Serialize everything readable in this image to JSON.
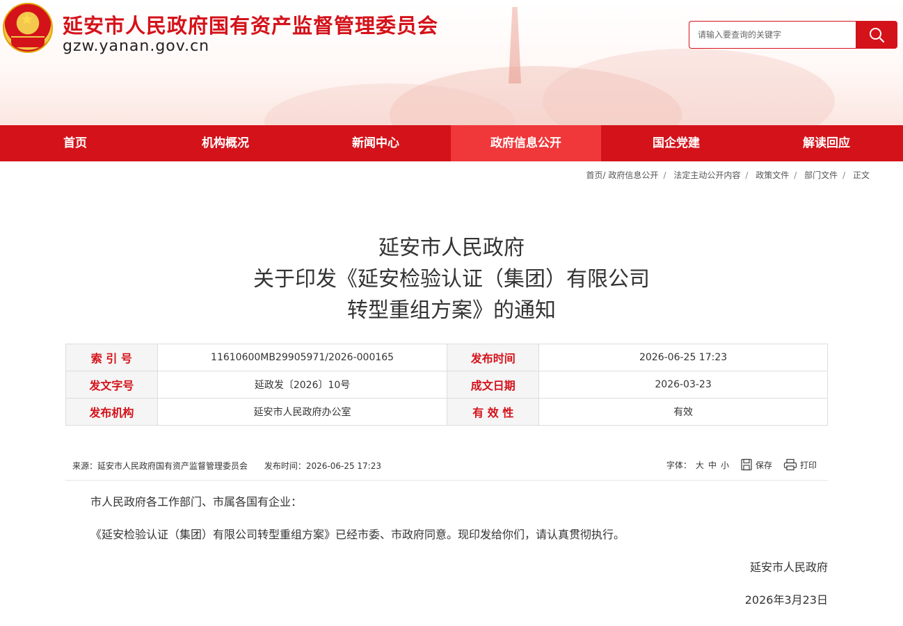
{
  "site": {
    "title": "延安市人民政府国有资产监督管理委员会",
    "domain": "gzw.yanan.gov.cn"
  },
  "search": {
    "placeholder": "请输入要查询的关键字",
    "icon": "search-icon"
  },
  "nav": {
    "items": [
      {
        "label": "首页"
      },
      {
        "label": "机构概况"
      },
      {
        "label": "新闻中心"
      },
      {
        "label": "政府信息公开"
      },
      {
        "label": "国企党建"
      },
      {
        "label": "解读回应"
      }
    ],
    "active_index": 3
  },
  "breadcrumb": [
    "首页/",
    "政府信息公开",
    "法定主动公开内容",
    "政策文件",
    "部门文件",
    "正文"
  ],
  "doc": {
    "title_lines": [
      "延安市人民政府",
      "关于印发《延安检验认证（集团）有限公司",
      "转型重组方案》的通知"
    ]
  },
  "meta": {
    "index_label": "索 引 号",
    "index_value": "11610600MB29905971/2026-000165",
    "publish_time_label": "发布时间",
    "publish_time_value": "2026-06-25 17:23",
    "doc_no_label": "发文字号",
    "doc_no_value": "延政发〔2026〕10号",
    "created_label": "成文日期",
    "created_value": "2026-03-23",
    "org_label": "发布机构",
    "org_value": "延安市人民政府办公室",
    "validity_label": "有 效 性",
    "validity_value": "有效"
  },
  "infobar": {
    "source": "来源：延安市人民政府国有资产监督管理委员会",
    "time": "发布时间：2026-06-25 17:23",
    "font_label": "字体：",
    "font_sizes": [
      "大",
      "中",
      "小"
    ],
    "save_label": "保存",
    "print_label": "打印"
  },
  "content": {
    "salutation": "市人民政府各工作部门、市属各国有企业：",
    "body": "《延安检验认证（集团）有限公司转型重组方案》已经市委、市政府同意。现印发给你们，请认真贯彻执行。",
    "signature": "延安市人民政府",
    "date": "2026年3月23日"
  },
  "colors": {
    "brand_red": "#d4121a",
    "nav_active": "#f0373a"
  }
}
